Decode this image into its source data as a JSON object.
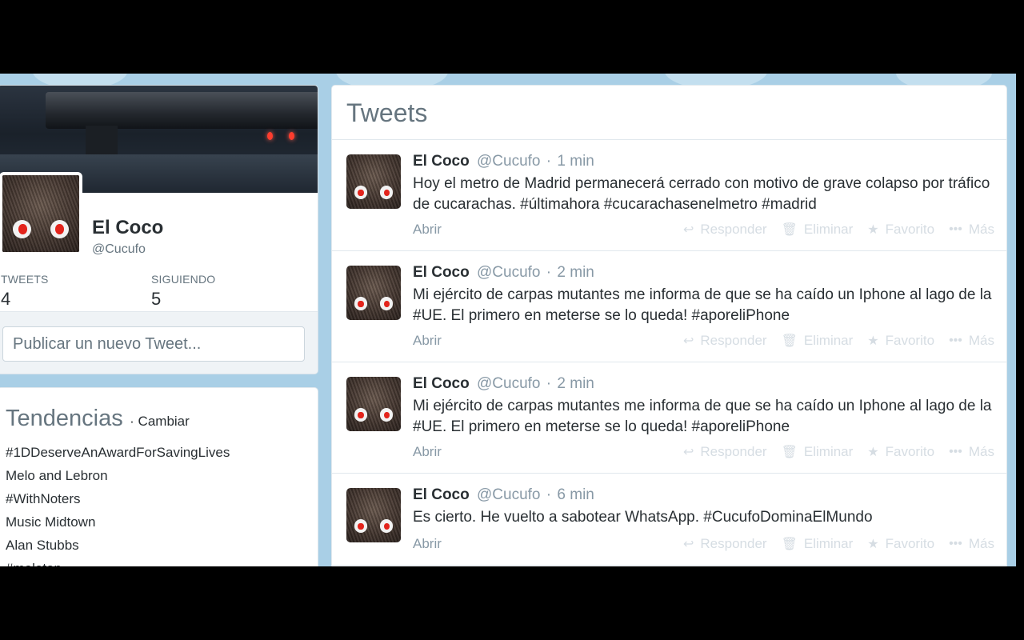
{
  "profile": {
    "name": "El Coco",
    "handle": "@Cucufo",
    "stats": {
      "tweets_label": "TWEETS",
      "tweets_value": "4",
      "following_label": "SIGUIENDO",
      "following_value": "5"
    },
    "composer_placeholder": "Publicar un nuevo Tweet..."
  },
  "trends": {
    "title": "Tendencias",
    "change_label": "· Cambiar",
    "items": [
      "#1DDeserveAnAwardForSavingLives",
      "Melo and Lebron",
      "#WithNoters",
      "Music Midtown",
      "Alan Stubbs",
      "#meletop"
    ]
  },
  "timeline": {
    "title": "Tweets",
    "tweets": [
      {
        "name": "El Coco",
        "handle": "@Cucufo",
        "dot": "·",
        "time": "1 min",
        "text": "Hoy el metro de Madrid permanecerá cerrado con motivo de grave colapso por tráfico de cucarachas.  #últimahora #cucarachasenelmetro #madrid",
        "open_label": "Abrir"
      },
      {
        "name": "El Coco",
        "handle": "@Cucufo",
        "dot": "·",
        "time": "2 min",
        "text": "Mi ejército de carpas mutantes me informa de que se ha caído un Iphone al lago de la #UE. El primero en meterse se lo queda! #aporeliPhone",
        "open_label": "Abrir"
      },
      {
        "name": "El Coco",
        "handle": "@Cucufo",
        "dot": "·",
        "time": "2 min",
        "text": "Mi ejército de carpas mutantes me informa de que se ha caído un Iphone al lago de la #UE. El primero en meterse se lo queda! #aporeliPhone",
        "open_label": "Abrir"
      },
      {
        "name": "El Coco",
        "handle": "@Cucufo",
        "dot": "·",
        "time": "6 min",
        "text": "Es cierto. He vuelto a sabotear WhatsApp. #CucufoDominaElMundo",
        "open_label": "Abrir"
      }
    ],
    "actions": {
      "reply": "Responder",
      "delete": "Eliminar",
      "favorite": "Favorito",
      "more": "Más"
    }
  },
  "icons": {
    "reply": "reply-arrow-icon",
    "delete": "trash-icon",
    "favorite": "star-icon",
    "more": "ellipsis-icon"
  },
  "colors": {
    "page_background": "#a9cfe6",
    "text": "#292f33",
    "muted": "#66757f",
    "inactive_action": "#d6dde3"
  }
}
